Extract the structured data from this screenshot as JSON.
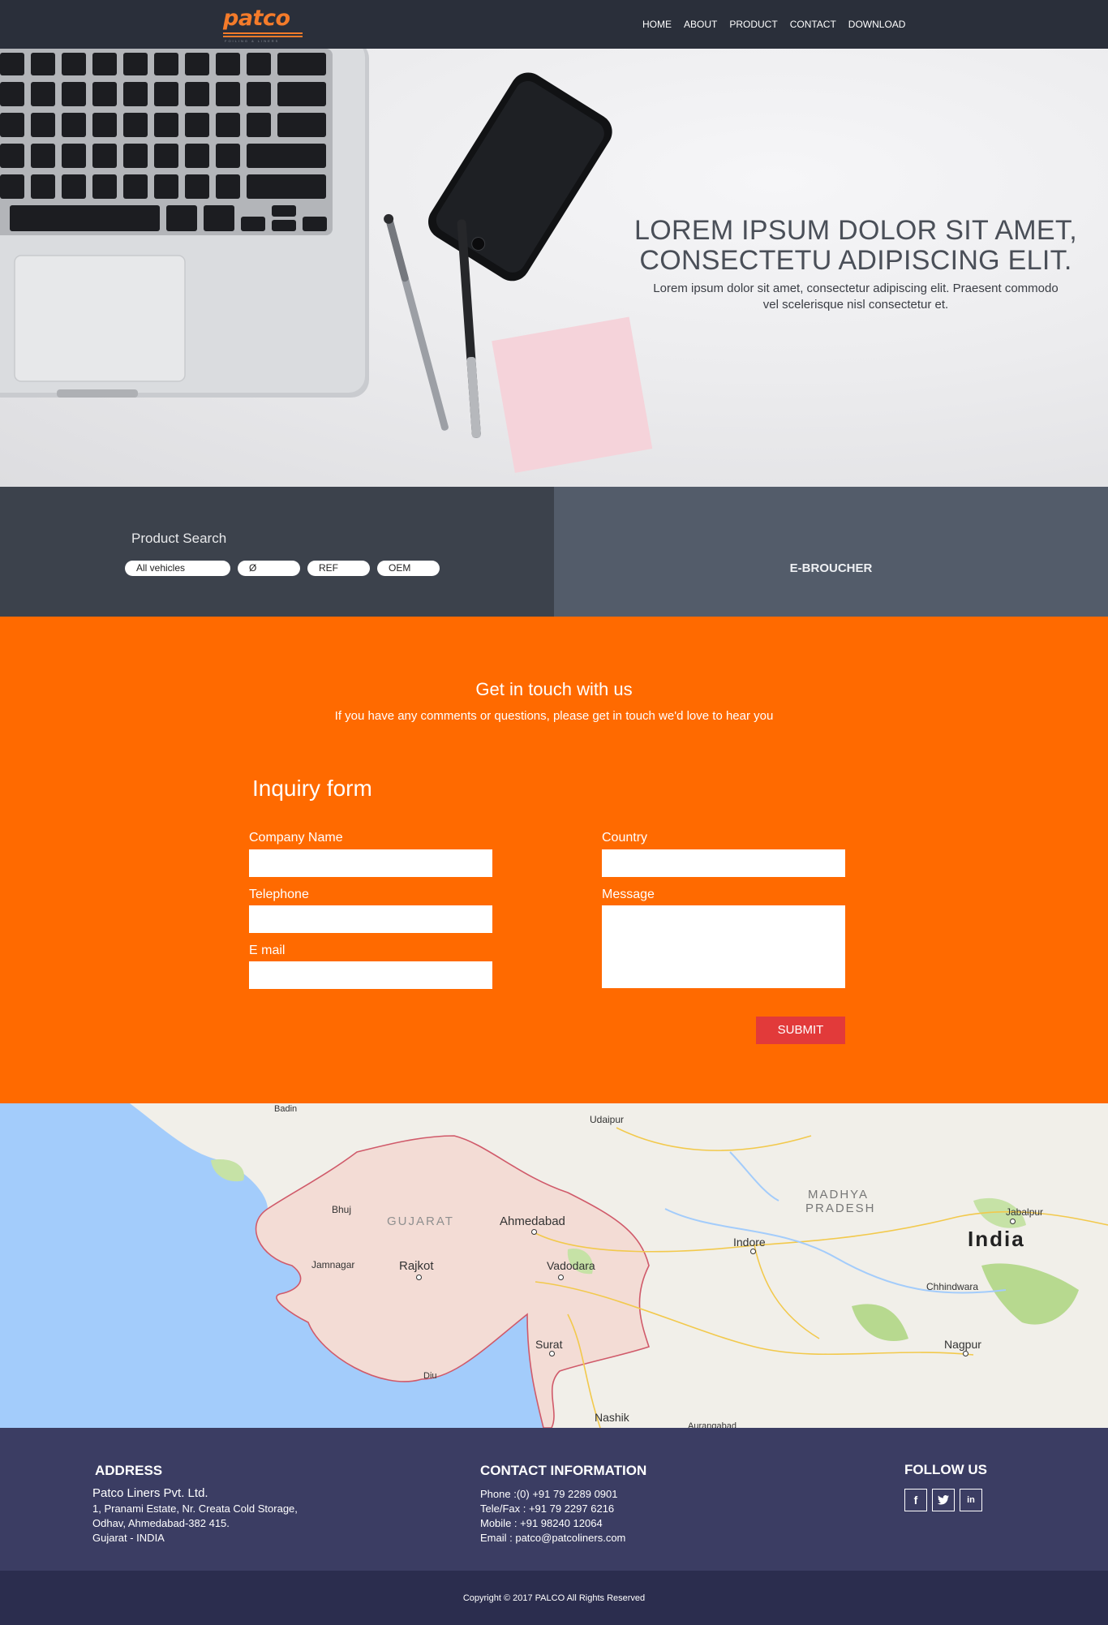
{
  "brand": {
    "logo_text": "patco",
    "logo_tagline": "FOILING & LINERS",
    "accent": "#f47b2a"
  },
  "nav": {
    "items": [
      "HOME",
      "ABOUT",
      "PRODUCT",
      "CONTACT",
      "DOWNLOAD"
    ]
  },
  "hero": {
    "title_line1": "LOREM IPSUM DOLOR SIT AMET,",
    "title_line2": "CONSECTETU ADIPISCING ELIT.",
    "subtitle_line1": "Lorem ipsum dolor sit amet, consectetur adipiscing elit. Praesent commodo",
    "subtitle_line2": "vel scelerisque nisl consectetur et."
  },
  "search": {
    "title": "Product Search",
    "chips": [
      "All vehicles",
      "Ø",
      "REF",
      "OEM"
    ]
  },
  "ebrochure": {
    "label": "E-BROUCHER"
  },
  "contact": {
    "title": "Get in touch with us",
    "subtitle": "If you have any comments or questions, please get in touch we'd love to hear you",
    "form_title": "Inquiry form",
    "labels": {
      "company": "Company Name",
      "telephone": "Telephone",
      "email": "E mail",
      "country": "Country",
      "message": "Message"
    },
    "submit_label": "SUBMIT",
    "background": "#ff6a00",
    "submit_color": "#e23a3a"
  },
  "map": {
    "labels": [
      "Badin",
      "Udaipur",
      "Bhuj",
      "GUJARAT",
      "Ahmedabad",
      "MADHYA",
      "PRADESH",
      "Jabalpur",
      "India",
      "Indore",
      "Jamnagar",
      "Rajkot",
      "Vadodara",
      "Chhindwara",
      "Surat",
      "Nagpur",
      "Diu",
      "Nashik",
      "Aurangabad"
    ]
  },
  "footer": {
    "address_title": "ADDRESS",
    "address_lines": [
      "Patco Liners Pvt. Ltd.",
      "1, Pranami Estate, Nr. Creata Cold Storage,",
      "Odhav, Ahmedabad-382 415.",
      "Gujarat - INDIA"
    ],
    "contact_title": "CONTACT INFORMATION",
    "contact_lines": [
      "Phone :(0) +91 79 2289 0901",
      "Tele/Fax : +91 79 2297 6216",
      "Mobile : +91 98240 12064",
      "Email : patco@patcoliners.com"
    ],
    "follow_title": "FOLLOW US",
    "social_icons": [
      "facebook-icon",
      "twitter-icon",
      "linkedin-icon"
    ],
    "copyright": "Copyright © 2017 PALCO All Rights Reserved"
  }
}
